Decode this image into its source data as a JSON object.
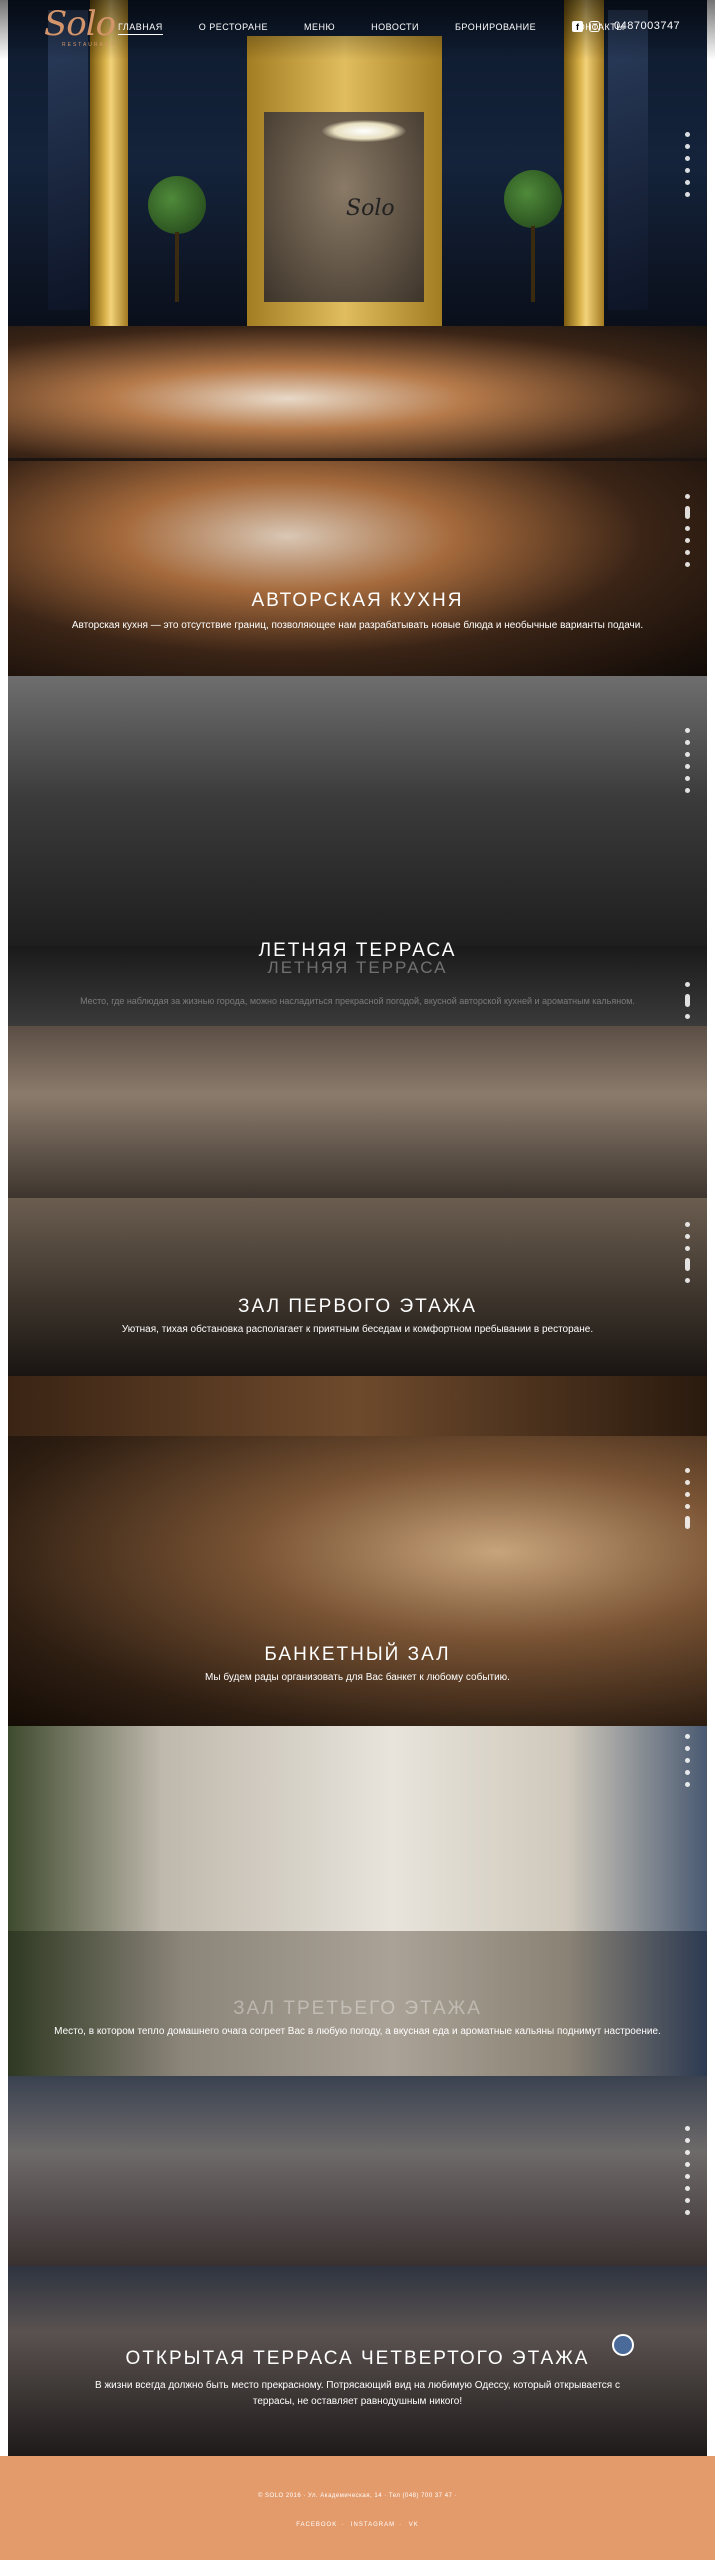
{
  "brand": {
    "logo": "Solo",
    "tagline": "RESTAURANT"
  },
  "nav": [
    "ГЛАВНАЯ",
    "О РЕСТОРАНЕ",
    "МЕНЮ",
    "НОВОСТИ",
    "БРОНИРОВАНИЕ",
    "КОНТАКТЫ"
  ],
  "phone": "0487003747",
  "socials": [
    "facebook-icon",
    "instagram-icon"
  ],
  "sections": [
    {
      "title": "АВТОРСКАЯ КУХНЯ",
      "desc": "Авторская кухня — это отсутствие границ, позволяющее нам разрабатывать новые блюда и необычные варианты подачи."
    },
    {
      "title": "ЛЕТНЯЯ ТЕРРАСА",
      "desc": "Место, где наблюдая за жизнью города, можно насладиться прекрасной погодой, вкусной авторской кухней и ароматным кальяном."
    },
    {
      "title": "ЗАЛ ПЕРВОГО ЭТАЖА",
      "desc": "Уютная, тихая обстановка располагает к приятным беседам и комфортном пребывании в ресторане."
    },
    {
      "title": "БАНКЕТНЫЙ ЗАЛ",
      "desc": "Мы будем рады организовать для Вас банкет к любому событию."
    },
    {
      "title": "ЗАЛ ТРЕТЬЕГО ЭТАЖА",
      "desc": "Место, в котором тепло домашнего очага согреет Вас в любую погоду, а вкусная еда и ароматные кальяны поднимут настроение."
    },
    {
      "title": "ОТКРЫТАЯ ТЕРРАСА ЧЕТВЕРТОГО ЭТАЖА",
      "desc_line1": "В жизни всегда должно быть место прекрасному. Потрясающий вид на любимую Одессу, который открывается с",
      "desc_line2": "террасы, не оставляет равнодушным никого!"
    }
  ],
  "footer": {
    "line": "© SOLO 2016 · Ул. Академическая, 14 · Тел (048) 700 37 47 ·",
    "links": [
      "FACEBOOK",
      "INSTAGRAM",
      "VK"
    ]
  },
  "colors": {
    "accent": "#e49b6b",
    "logo": "#d4956a"
  }
}
